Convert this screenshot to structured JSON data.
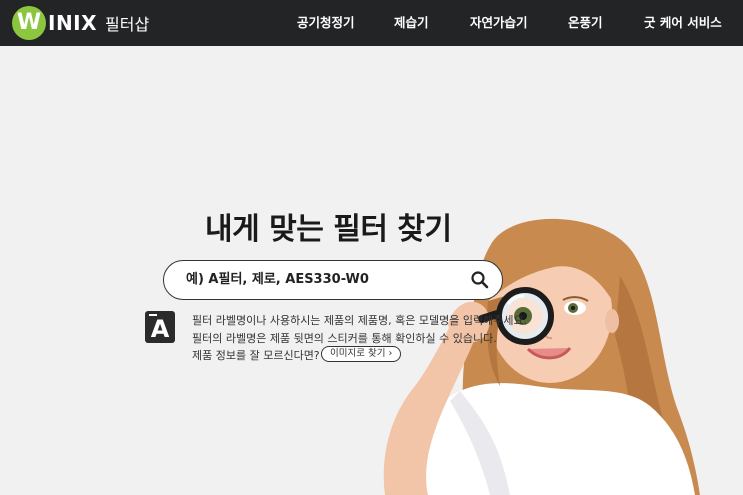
{
  "header": {
    "logo_letter": "W",
    "logo_word": "INIX",
    "logo_sub": "필터샵",
    "nav": [
      "공기청정기",
      "제습기",
      "자연가습기",
      "온풍기",
      "굿 케어 서비스"
    ]
  },
  "hero": {
    "title": "내게 맞는 필터 찾기",
    "search": {
      "placeholder": "예) A필터, 제로, AES330-W0"
    },
    "info_icon_letter": "A",
    "info_lines": [
      "필터 라벨명이나 사용하시는 제품의 제품명, 혹은 모델명을 입력해주세요.",
      "필터의 라벨명은 제품 뒷면의 스티커를 통해 확인하실 수 있습니다.",
      "제품 정보를 잘 모르신다면?"
    ],
    "image_search_button": "이미지로 찾기 ›"
  },
  "colors": {
    "header_bg": "#222426",
    "logo_green": "#8cc63f",
    "page_bg": "#f1f1f1"
  }
}
